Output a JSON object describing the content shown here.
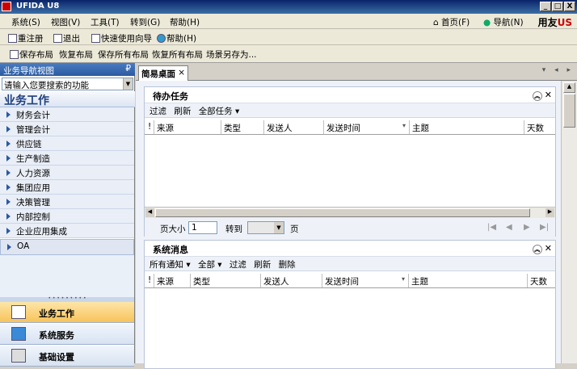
{
  "window": {
    "title": "UFIDA U8",
    "controls": [
      "_",
      "□",
      "X"
    ]
  },
  "menu": {
    "items": [
      "系统(S)",
      "视图(V)",
      "工具(T)",
      "转到(G)",
      "帮助(H)"
    ],
    "home": "首页(F)",
    "nav": "导航(N)",
    "brand": "用友",
    "brand_mark": "US"
  },
  "toolbar1": {
    "items": [
      "重注册",
      "退出",
      "快速使用向导",
      "帮助(H)"
    ]
  },
  "toolbar2": {
    "items": [
      "保存布局",
      "恢复布局",
      "保存所有布局",
      "恢复所有布局",
      "场景另存为..."
    ]
  },
  "nav": {
    "title": "业务导航视图",
    "pin": "₽",
    "search_placeholder": "请输入您要搜索的功能",
    "heading": "业务工作",
    "items": [
      "财务会计",
      "管理会计",
      "供应链",
      "生产制造",
      "人力资源",
      "集团应用",
      "决策管理",
      "内部控制",
      "企业应用集成",
      "OA"
    ],
    "bottom": [
      "业务工作",
      "系统服务",
      "基础设置"
    ]
  },
  "tabs": {
    "active": "简易桌面",
    "close": "×",
    "nav_arrows": "▾ ◂ ▸"
  },
  "todo": {
    "title": "待办任务",
    "tools": [
      "过滤",
      "刷新",
      "全部任务 ▾"
    ],
    "columns": [
      "!",
      "来源",
      "类型",
      "发送人",
      "发送时间",
      "主题",
      "天数"
    ],
    "sort_mark": "▾",
    "pager": {
      "page_size_label": "页大小",
      "page_size": "1",
      "goto_label": "转到",
      "page_unit": "页"
    }
  },
  "messages": {
    "title": "系统消息",
    "tools": [
      "所有通知 ▾",
      "全部 ▾",
      "过滤",
      "刷新",
      "删除"
    ],
    "columns": [
      "!",
      "来源",
      "类型",
      "发送人",
      "发送时间",
      "主题",
      "天数"
    ],
    "sort_mark": "▾"
  }
}
